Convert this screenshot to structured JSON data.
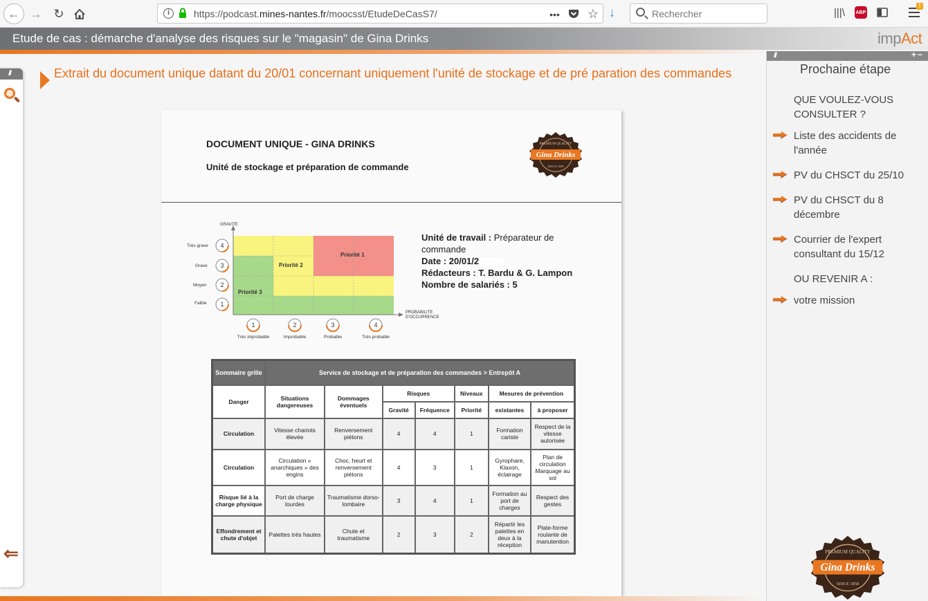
{
  "browser": {
    "url_prefix": "https://podcast.",
    "url_domain": "mines-nantes.fr",
    "url_path": "/moocsst/EtudeDeCasS7/",
    "search_placeholder": "Rechercher",
    "more_label": "•••",
    "abp_label": "ABP",
    "menu_badge": "!"
  },
  "header": {
    "title": "Etude de cas : démarche d'analyse des risques sur le \"magasin\" de Gina Drinks",
    "logo_prefix": "imp",
    "logo_suffix": "Act"
  },
  "content": {
    "title": "Extrait du document unique datant du 20/01 concernant uniquement l'unité  de stockage et de pré paration des commandes"
  },
  "document": {
    "heading": "DOCUMENT UNIQUE - GINA DRINKS",
    "subheading": "Unité de stockage et préparation de commande",
    "logo_top": "PREMIUM QUALITY",
    "logo_name": "Gina Drinks",
    "logo_bottom": "SINCE 1858",
    "matrix": {
      "y_axis_label": "GRAVITE",
      "x_axis_label_1": "PROBABILITE",
      "x_axis_label_2": "D'OCCURRENCE",
      "y_levels": [
        {
          "num": "4",
          "label": "Très grave"
        },
        {
          "num": "3",
          "label": "Grave"
        },
        {
          "num": "2",
          "label": "Moyen"
        },
        {
          "num": "1",
          "label": "Faible"
        }
      ],
      "x_levels": [
        {
          "num": "1",
          "label": "Très improbable"
        },
        {
          "num": "2",
          "label": "Improbable"
        },
        {
          "num": "3",
          "label": "Probable"
        },
        {
          "num": "4",
          "label": "Très probable"
        }
      ],
      "priority_1": "Priorité 1",
      "priority_2": "Priorité 2",
      "priority_3": "Priorité 3",
      "colors": {
        "red": "#f4908a",
        "yellow": "#f9f47f",
        "green": "#a6d98a"
      }
    },
    "info": {
      "unit_label": "Unité de travail :",
      "unit_value": "Préparateur de commande",
      "date_label": "Date :",
      "date_value": "20/01/2",
      "authors_label": "Rédacteurs :",
      "authors_value": "T. Bardu & G. Lampon",
      "staff_label": "Nombre de salariés :",
      "staff_value": "5"
    },
    "table": {
      "summary": "Sommaire grille",
      "service": "Service de stockage et de préparation des commandes > Entrepôt A",
      "col_danger": "Danger",
      "col_situations": "Situations dangereuses",
      "col_dommages": "Dommages éventuels",
      "col_risques": "Risques",
      "col_niveaux": "Niveaux",
      "col_mesures": "Mesures de prévention",
      "sub_gravite": "Gravité",
      "sub_frequence": "Fréquence",
      "sub_priorite": "Priorité",
      "sub_existantes": "existantes",
      "sub_proposer": "à proposer",
      "rows": [
        {
          "danger": "Circulation",
          "situation": "Vitesse chariots élevée",
          "dommage": "Renversement piétons",
          "gravite": "4",
          "frequence": "4",
          "priorite": "1",
          "existantes": "Formation cariste",
          "proposer": "Respect de la vitesse autorisée"
        },
        {
          "danger": "Circulation",
          "situation": "Circulation « anarchiques » des engins",
          "dommage": "Choc, heurt et renversement piétons",
          "gravite": "4",
          "frequence": "3",
          "priorite": "1",
          "existantes": "Gyrophare, Klaxon, éclairage",
          "proposer": "Plan de circulation Marquage au sol"
        },
        {
          "danger": "Risque lié à la charge physique",
          "situation": "Port de charge lourdes",
          "dommage": "Traumatisme dorso-lombaire",
          "gravite": "3",
          "frequence": "4",
          "priorite": "1",
          "existantes": "Formation au port de charges",
          "proposer": "Respect des gestes"
        },
        {
          "danger": "Effondrement et chute d'objet",
          "situation": "Palettes très hautes",
          "dommage": "Chute et traumatisme",
          "gravite": "2",
          "frequence": "3",
          "priorite": "2",
          "existantes": "Répartir les palettes en deux à la réception",
          "proposer": "Plate-forme roulante de manutention"
        }
      ]
    }
  },
  "right_panel": {
    "title": "Prochaine étape",
    "consult_heading": "QUE VOULEZ-VOUS CONSULTER ?",
    "links": [
      "Liste des accidents de l'année",
      "PV du CHSCT du 25/10",
      "PV du CHSCT du 8 décembre",
      "Courrier de l'expert consultant du 15/12"
    ],
    "return_heading": "OU REVENIR A :",
    "return_link": "votre mission",
    "panel_controls": "+−"
  },
  "accent_color": "#e87722"
}
